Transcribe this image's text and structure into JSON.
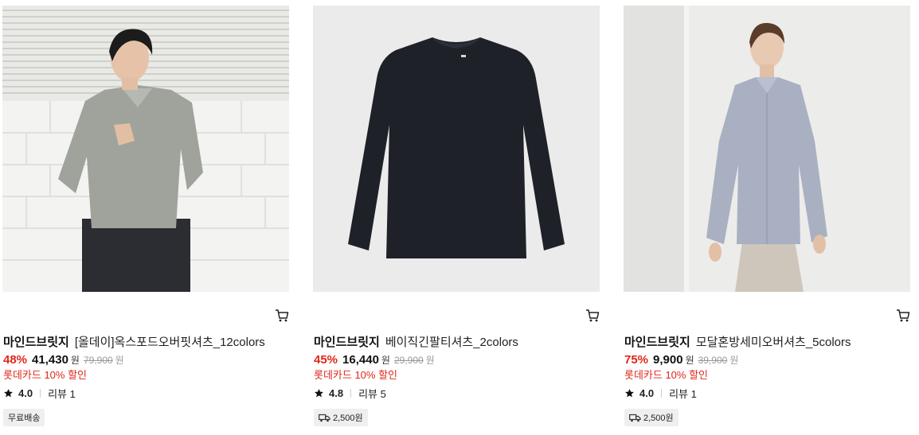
{
  "products": [
    {
      "brand": "마인드브릿지",
      "name": "[올데이]옥스포드오버핏셔츠_12colors",
      "discount_rate": "48%",
      "sale_price": "41,430",
      "sale_unit": "원",
      "original_price": "79,900",
      "original_unit": "원",
      "card_discount": "롯데카드 10% 할인",
      "rating": "4.0",
      "reviews": "리뷰 1",
      "shipping": "무료배송",
      "shipping_icon": ""
    },
    {
      "brand": "마인드브릿지",
      "name": "베이직긴팔티셔츠_2colors",
      "discount_rate": "45%",
      "sale_price": "16,440",
      "sale_unit": "원",
      "original_price": "29,900",
      "original_unit": "원",
      "card_discount": "롯데카드 10% 할인",
      "rating": "4.8",
      "reviews": "리뷰 5",
      "shipping": "2,500원",
      "shipping_icon": "truck-icon"
    },
    {
      "brand": "마인드브릿지",
      "name": "모달혼방세미오버셔츠_5colors",
      "discount_rate": "75%",
      "sale_price": "9,900",
      "sale_unit": "원",
      "original_price": "39,900",
      "original_unit": "원",
      "card_discount": "롯데카드 10% 할인",
      "rating": "4.0",
      "reviews": "리뷰 1",
      "shipping": "2,500원",
      "shipping_icon": "truck-icon"
    }
  ],
  "colors": {
    "discount_red": "#e0271a",
    "badge_bg": "#efefef"
  },
  "icons": {
    "cart": "cart-icon",
    "star": "star-icon"
  }
}
